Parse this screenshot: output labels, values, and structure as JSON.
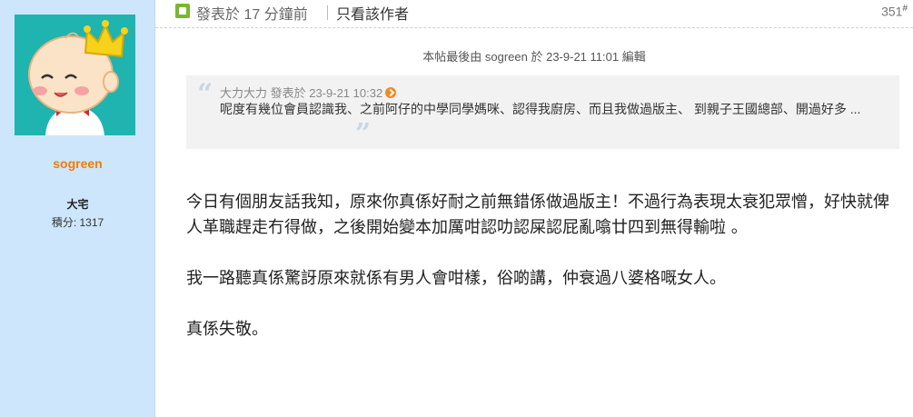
{
  "user": {
    "name": "sogreen",
    "rank": "大宅",
    "score": "積分: 1317"
  },
  "header": {
    "posted": "發表於 17 分鐘前",
    "author_only": "只看該作者",
    "floor": "351",
    "floor_mark": "#"
  },
  "edit_note": "本帖最後由 sogreen 於 23-9-21 11:01 編輯",
  "quote": {
    "head": "大力大力 發表於 23-9-21 10:32",
    "body": "呢度有幾位會員認識我、之前阿仔的中學同學媽咪、認得我廚房、而且我做過版主、 到親子王國總部、開過好多 ..."
  },
  "content": {
    "p1": "今日有個朋友話我知，原來你真係好耐之前無錯係做過版主！不過行為表現太衰犯眾憎，好快就俾人革職趕走冇得做，之後開始變本加厲咁認叻認屎認屁亂噏廿四到無得輸啦 。",
    "p2": "我一路聽真係驚訝原來就係有男人會咁樣，俗啲講，仲衰過八婆格嘅女人。",
    "p3": "真係失敬。"
  },
  "colors": {
    "sidebar_bg": "#cde6fb",
    "avatar_bg": "#1fb4b0",
    "username": "#f07c00",
    "quote_bg": "#f2f2f2"
  }
}
